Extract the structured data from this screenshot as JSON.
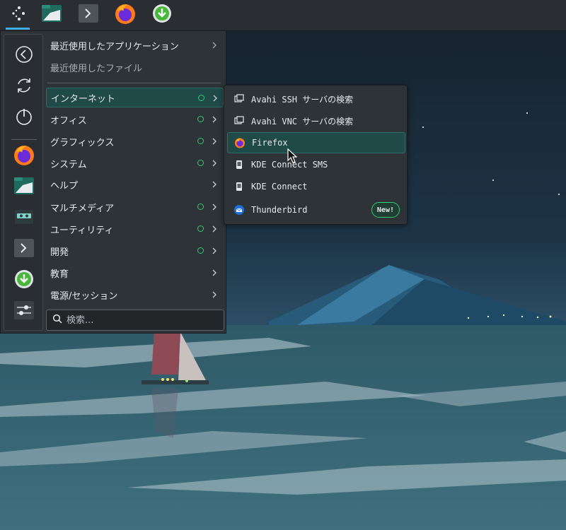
{
  "panel": {
    "items": [
      {
        "name": "application-launcher",
        "icon": "launcher-icon"
      },
      {
        "name": "file-manager",
        "icon": "folder-icon"
      },
      {
        "name": "terminal",
        "icon": "terminal-icon"
      },
      {
        "name": "firefox",
        "icon": "firefox-icon"
      },
      {
        "name": "downloader",
        "icon": "download-icon"
      }
    ]
  },
  "favorites": [
    {
      "icon": "back-icon"
    },
    {
      "icon": "refresh-icon"
    },
    {
      "icon": "power-icon"
    },
    {
      "icon": "firefox-icon"
    },
    {
      "icon": "folder-icon"
    },
    {
      "icon": "cassette-icon"
    },
    {
      "icon": "terminal-icon"
    },
    {
      "icon": "download-icon"
    },
    {
      "icon": "settings-icon"
    }
  ],
  "menu": {
    "recent_apps": "最近使用したアプリケーション",
    "recent_files": "最近使用したファイル",
    "categories": [
      {
        "label": "インターネット",
        "new_dot": true
      },
      {
        "label": "オフィス",
        "new_dot": true
      },
      {
        "label": "グラフィックス",
        "new_dot": true
      },
      {
        "label": "システム",
        "new_dot": true
      },
      {
        "label": "ヘルプ",
        "new_dot": false
      },
      {
        "label": "マルチメディア",
        "new_dot": true
      },
      {
        "label": "ユーティリティ",
        "new_dot": true
      },
      {
        "label": "開発",
        "new_dot": true
      },
      {
        "label": "教育",
        "new_dot": false
      },
      {
        "label": "電源/セッション",
        "new_dot": false
      }
    ],
    "search_placeholder": "検索..."
  },
  "submenu": {
    "items": [
      {
        "label": "Avahi SSH サーバの検索",
        "icon": "network-icon"
      },
      {
        "label": "Avahi VNC サーバの検索",
        "icon": "network-icon"
      },
      {
        "label": "Firefox",
        "icon": "firefox-icon"
      },
      {
        "label": "KDE Connect SMS",
        "icon": "phone-icon"
      },
      {
        "label": "KDE Connect",
        "icon": "phone-icon"
      },
      {
        "label": "Thunderbird",
        "icon": "thunderbird-icon",
        "badge": "New!"
      }
    ]
  },
  "colors": {
    "accent": "#3daee9",
    "highlight": "#1f4a48",
    "new_indicator": "#2ecc71"
  }
}
